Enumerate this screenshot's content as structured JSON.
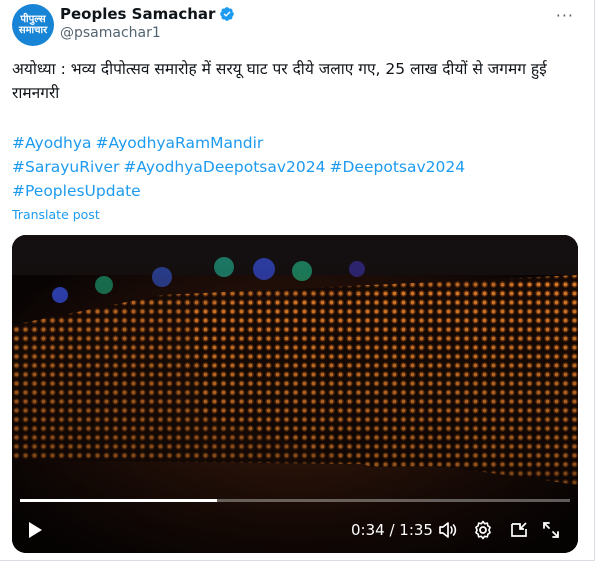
{
  "author": {
    "name": "Peoples Samachar",
    "handle": "@psamachar1",
    "avatar_text_line1": "पीपुल्स",
    "avatar_text_line2": "समाचार",
    "avatar_color": "#1784d6",
    "verified": true,
    "verified_icon": "verified-badge-icon"
  },
  "more_label": "···",
  "post_text": "अयोध्या : भव्य दीपोत्सव समारोह में सरयू घाट पर दीये जलाए गए, 25 लाख दीयों से जगमग हुई रामनगरी",
  "hashtags": [
    "#Ayodhya",
    "#AyodhyaRamMandir",
    "#SarayuRiver",
    "#AyodhyaDeepotsav2024",
    "#Deepotsav2024",
    "#PeoplesUpdate"
  ],
  "translate_label": "Translate post",
  "video": {
    "current_time": "0:34",
    "duration": "1:35",
    "time_display": "0:34 / 1:35",
    "progress": 0.358,
    "icons": [
      "play-icon",
      "volume-icon",
      "settings-icon",
      "fullscreen-exit-icon",
      "expand-icon"
    ]
  },
  "colors": {
    "link": "#1d9bf0",
    "secondary_text": "#536471",
    "lamp_glow": "#ff9a3c"
  }
}
